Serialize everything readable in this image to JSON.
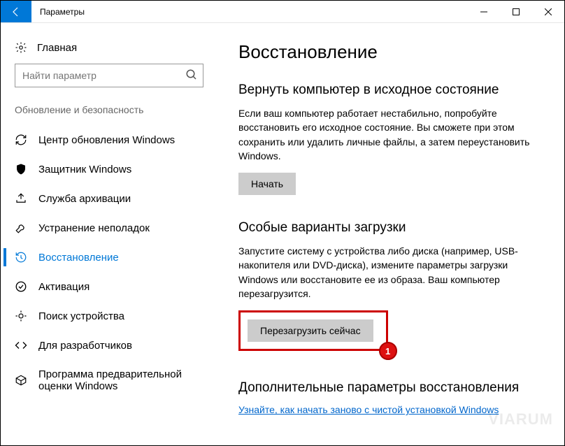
{
  "window": {
    "title": "Параметры"
  },
  "sidebar": {
    "home": "Главная",
    "search_placeholder": "Найти параметр",
    "section": "Обновление и безопасность",
    "items": [
      {
        "label": "Центр обновления Windows"
      },
      {
        "label": "Защитник Windows"
      },
      {
        "label": "Служба архивации"
      },
      {
        "label": "Устранение неполадок"
      },
      {
        "label": "Восстановление"
      },
      {
        "label": "Активация"
      },
      {
        "label": "Поиск устройства"
      },
      {
        "label": "Для разработчиков"
      },
      {
        "label": "Программа предварительной оценки Windows"
      }
    ]
  },
  "main": {
    "title": "Восстановление",
    "sec1": {
      "heading": "Вернуть компьютер в исходное состояние",
      "body": "Если ваш компьютер работает нестабильно, попробуйте восстановить его исходное состояние. Вы сможете при этом сохранить или удалить личные файлы, а затем переустановить Windows.",
      "btn": "Начать"
    },
    "sec2": {
      "heading": "Особые варианты загрузки",
      "body": "Запустите систему с устройства либо диска (например, USB-накопителя или DVD-диска), измените параметры загрузки Windows или восстановите ее из образа. Ваш компьютер перезагрузится.",
      "btn": "Перезагрузить сейчас"
    },
    "sec3": {
      "heading": "Дополнительные параметры восстановления",
      "link": "Узнайте, как начать заново с чистой установкой Windows"
    }
  },
  "annotation": {
    "number": "1"
  },
  "watermark": "VIARUM"
}
